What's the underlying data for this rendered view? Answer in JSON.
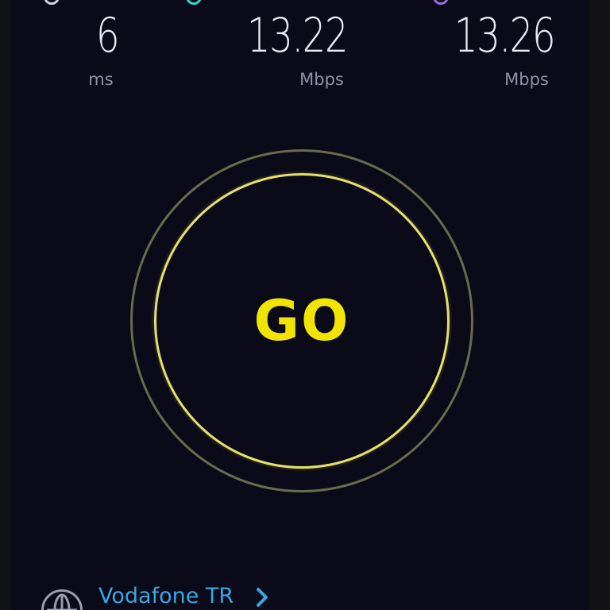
{
  "metrics": {
    "ping": {
      "value": "6",
      "unit": "ms",
      "icon": "ping-icon"
    },
    "download": {
      "value": "13.22",
      "unit": "Mbps",
      "icon": "download-icon"
    },
    "upload": {
      "value": "13.26",
      "unit": "Mbps",
      "icon": "upload-icon"
    }
  },
  "go_button": {
    "label": "GO"
  },
  "provider": {
    "name": "Vodafone TR",
    "icon": "globe-icon"
  },
  "colors": {
    "background": "#0a0a18",
    "go_yellow": "#f0e400",
    "provider_blue": "#37a7e6",
    "download_accent": "#2bd8c4",
    "upload_accent": "#9a6bd8"
  }
}
